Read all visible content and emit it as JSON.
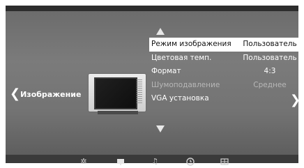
{
  "section": {
    "label": "Изображение"
  },
  "menu": {
    "items": [
      {
        "label": "Режим изображения",
        "value": "Пользователь",
        "selected": true,
        "enabled": true
      },
      {
        "label": "Цветовая темп.",
        "value": "Пользователь",
        "selected": false,
        "enabled": true
      },
      {
        "label": "Формат",
        "value": "4:3",
        "selected": false,
        "enabled": true
      },
      {
        "label": "Шумоподавление",
        "value": "Среднее",
        "selected": false,
        "enabled": false
      },
      {
        "label": "VGA установка",
        "value": "",
        "selected": false,
        "enabled": true
      }
    ]
  },
  "nav_icons": [
    "sun-icon",
    "monitor-icon",
    "music-note-icon",
    "clock-icon",
    "grid-icon"
  ],
  "colors": {
    "osd_background": "#737373",
    "selected_row": "#ffffff",
    "bottom_bar": "#3a3a3a"
  }
}
